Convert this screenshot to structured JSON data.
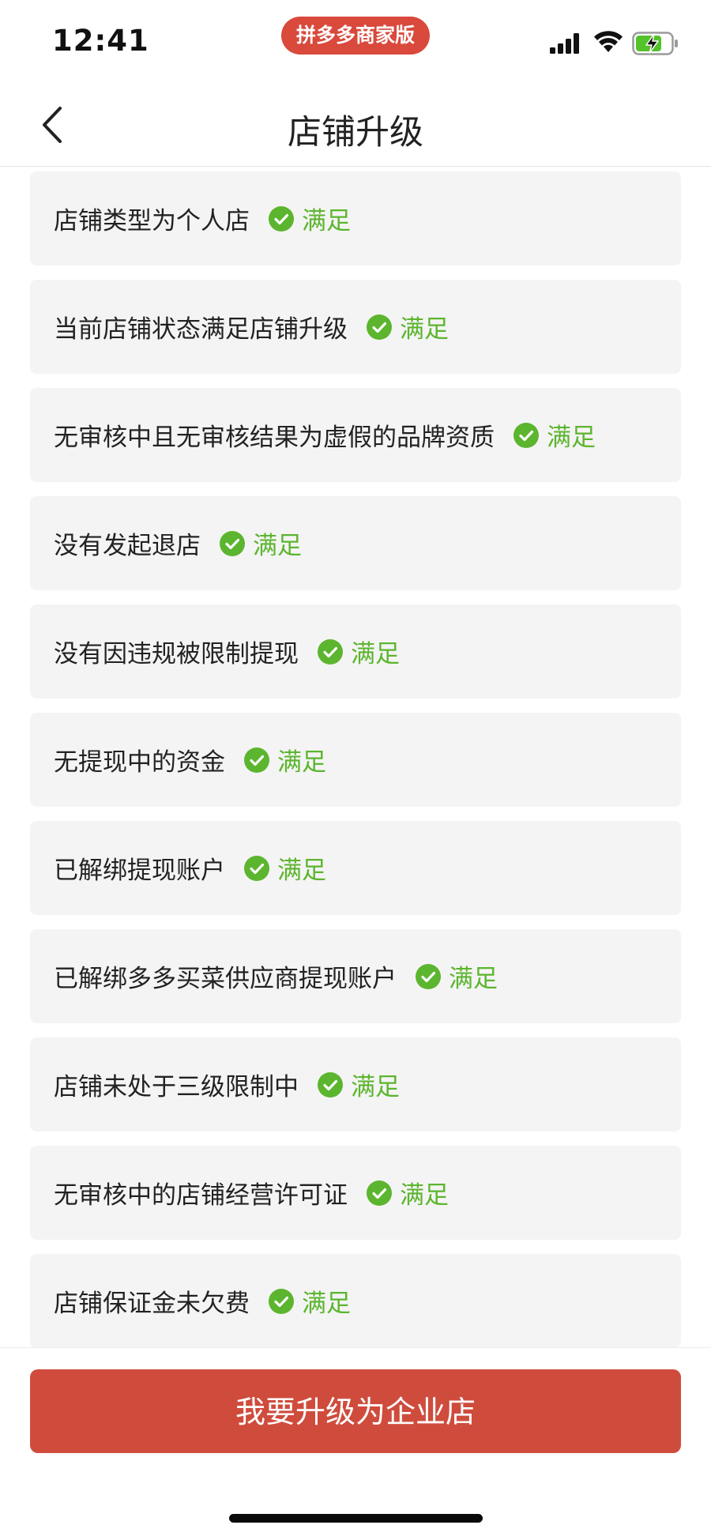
{
  "status_bar": {
    "time": "12:41",
    "app_badge": "拼多多商家版"
  },
  "nav": {
    "title": "店铺升级"
  },
  "colors": {
    "accent_red": "#cf4c3d",
    "success_green": "#5cb52e",
    "row_background": "#f4f4f4"
  },
  "requirements": [
    {
      "label": "店铺类型为个人店",
      "status": "满足",
      "icon": "check-circle-icon"
    },
    {
      "label": "当前店铺状态满足店铺升级",
      "status": "满足",
      "icon": "check-circle-icon"
    },
    {
      "label": "无审核中且无审核结果为虚假的品牌资质",
      "status": "满足",
      "icon": "check-circle-icon"
    },
    {
      "label": "没有发起退店",
      "status": "满足",
      "icon": "check-circle-icon"
    },
    {
      "label": "没有因违规被限制提现",
      "status": "满足",
      "icon": "check-circle-icon"
    },
    {
      "label": "无提现中的资金",
      "status": "满足",
      "icon": "check-circle-icon"
    },
    {
      "label": "已解绑提现账户",
      "status": "满足",
      "icon": "check-circle-icon"
    },
    {
      "label": "已解绑多多买菜供应商提现账户",
      "status": "满足",
      "icon": "check-circle-icon"
    },
    {
      "label": "店铺未处于三级限制中",
      "status": "满足",
      "icon": "check-circle-icon"
    },
    {
      "label": "无审核中的店铺经营许可证",
      "status": "满足",
      "icon": "check-circle-icon"
    },
    {
      "label": "店铺保证金未欠费",
      "status": "满足",
      "icon": "check-circle-icon"
    }
  ],
  "footer": {
    "upgrade_button": "我要升级为企业店"
  }
}
